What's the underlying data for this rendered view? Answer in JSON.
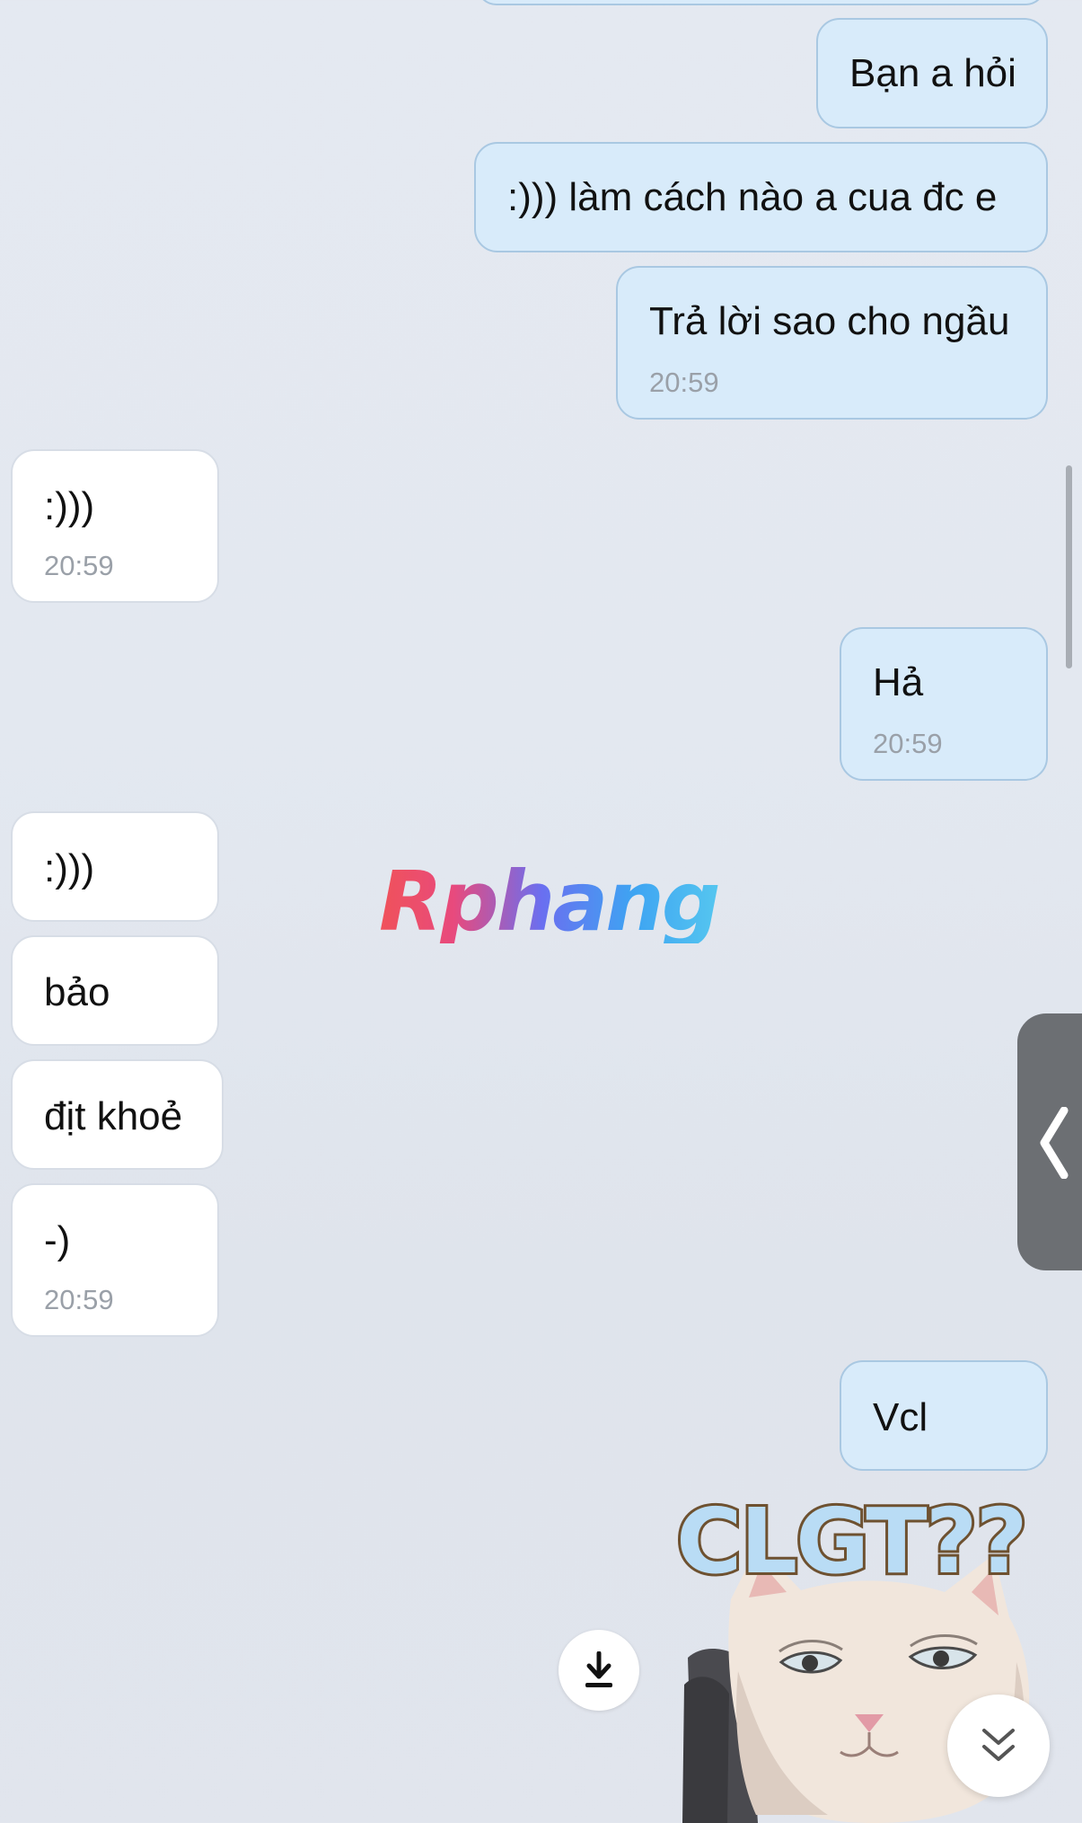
{
  "messages": [
    {
      "text": "Bạn a hỏi",
      "time": null
    },
    {
      "text": ":))) làm cách nào a cua đc e",
      "time": null
    },
    {
      "text": "Trả lời sao cho ngầu",
      "time": "20:59"
    },
    {
      "text": ":)))",
      "time": "20:59"
    },
    {
      "text": "Hả",
      "time": "20:59"
    },
    {
      "text": ":)))",
      "time": null
    },
    {
      "text": "bảo",
      "time": null
    },
    {
      "text": "địt khoẻ",
      "time": null
    },
    {
      "text": "-)",
      "time": "20:59"
    },
    {
      "text": "Vcl",
      "time": null
    }
  ],
  "watermark": "Rphang",
  "sticker": {
    "caption": "CLGT??"
  },
  "icons": {
    "side_tab": "chevron-left-icon",
    "download": "download-icon",
    "scroll_down": "double-chevron-down-icon"
  },
  "colors": {
    "outgoing_bubble": "#d8ebfa",
    "incoming_bubble": "#ffffff",
    "background": "#e3e8f0"
  }
}
